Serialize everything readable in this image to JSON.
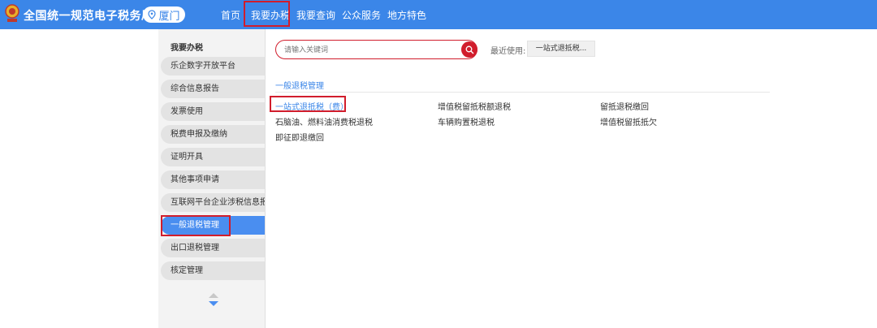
{
  "header": {
    "site_title": "全国统一规范电子税务局",
    "city": "厦门",
    "nav": [
      {
        "label": "首页"
      },
      {
        "label": "我要办税",
        "active": true
      },
      {
        "label": "我要查询"
      },
      {
        "label": "公众服务"
      },
      {
        "label": "地方特色"
      }
    ],
    "colors": {
      "bar": "#3b86e8",
      "highlight": "#d11d2c"
    }
  },
  "sidebar": {
    "title": "我要办税",
    "items": [
      {
        "label": "乐企数字开放平台"
      },
      {
        "label": "综合信息报告"
      },
      {
        "label": "发票使用"
      },
      {
        "label": "税费申报及缴纳"
      },
      {
        "label": "证明开具"
      },
      {
        "label": "其他事项申请"
      },
      {
        "label": "互联网平台企业涉税信息报送"
      },
      {
        "label": "一般退税管理",
        "active": true
      },
      {
        "label": "出口退税管理"
      },
      {
        "label": "核定管理"
      }
    ]
  },
  "search": {
    "placeholder": "请输入关键词",
    "button_icon": "search-icon"
  },
  "recent": {
    "label": "最近使用:",
    "items": [
      "一站式退抵税..."
    ]
  },
  "main": {
    "section_title": "一般退税管理",
    "links": [
      {
        "label": "一站式退抵税（费）",
        "highlighted": true
      },
      {
        "label": "增值税留抵税额退税"
      },
      {
        "label": "留抵退税缴回"
      },
      {
        "label": "石脑油、燃料油消费税退税"
      },
      {
        "label": "车辆购置税退税"
      },
      {
        "label": "增值税留抵抵欠"
      },
      {
        "label": "即征即退缴回"
      }
    ]
  }
}
